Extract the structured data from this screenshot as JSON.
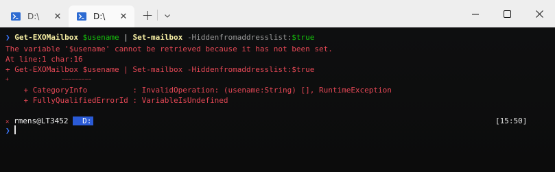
{
  "tabs": [
    {
      "title": "D:\\",
      "active": false
    },
    {
      "title": "D:\\",
      "active": true
    }
  ],
  "tab_close_glyph": "✕",
  "new_tab_glyph": "+",
  "dropdown_glyph": "⌄",
  "terminal": {
    "cmd1": {
      "arrow": "❯",
      "get": "Get-EXOMailbox",
      "var": "$usename",
      "pipe": "|",
      "set": "Set-mailbox",
      "param": "-Hiddenfromaddresslist:",
      "value": "$true"
    },
    "error_lines": [
      "The variable '$usename' cannot be retrieved because it has not been set.",
      "At line:1 char:16",
      "+ Get-EXOMailbox $usename | Set-mailbox -Hiddenfromaddresslist:$true",
      "+                ~~~~~~~~~",
      "    + CategoryInfo          : InvalidOperation: (usename:String) [], RuntimeException",
      "    + FullyQualifiedErrorId : VariableIsUndefined"
    ],
    "prompt": {
      "status": "✕",
      "user_host": "rmens@LT3452",
      "drive": "D:",
      "time": "[15:50]",
      "arrow": "❯"
    }
  },
  "colors": {
    "titlebar_bg": "#eeeeee",
    "terminal_bg": "#0c0c0c",
    "error": "#e74856",
    "command": "#f9f1a5",
    "variable": "#16c60c",
    "prompt_arrow": "#3b78ff",
    "drive_segment": "#2a5ad6"
  },
  "icons": [
    "powershell-icon",
    "close-icon",
    "plus-icon",
    "chevron-down-icon",
    "minimize-icon",
    "maximize-icon",
    "window-close-icon"
  ]
}
